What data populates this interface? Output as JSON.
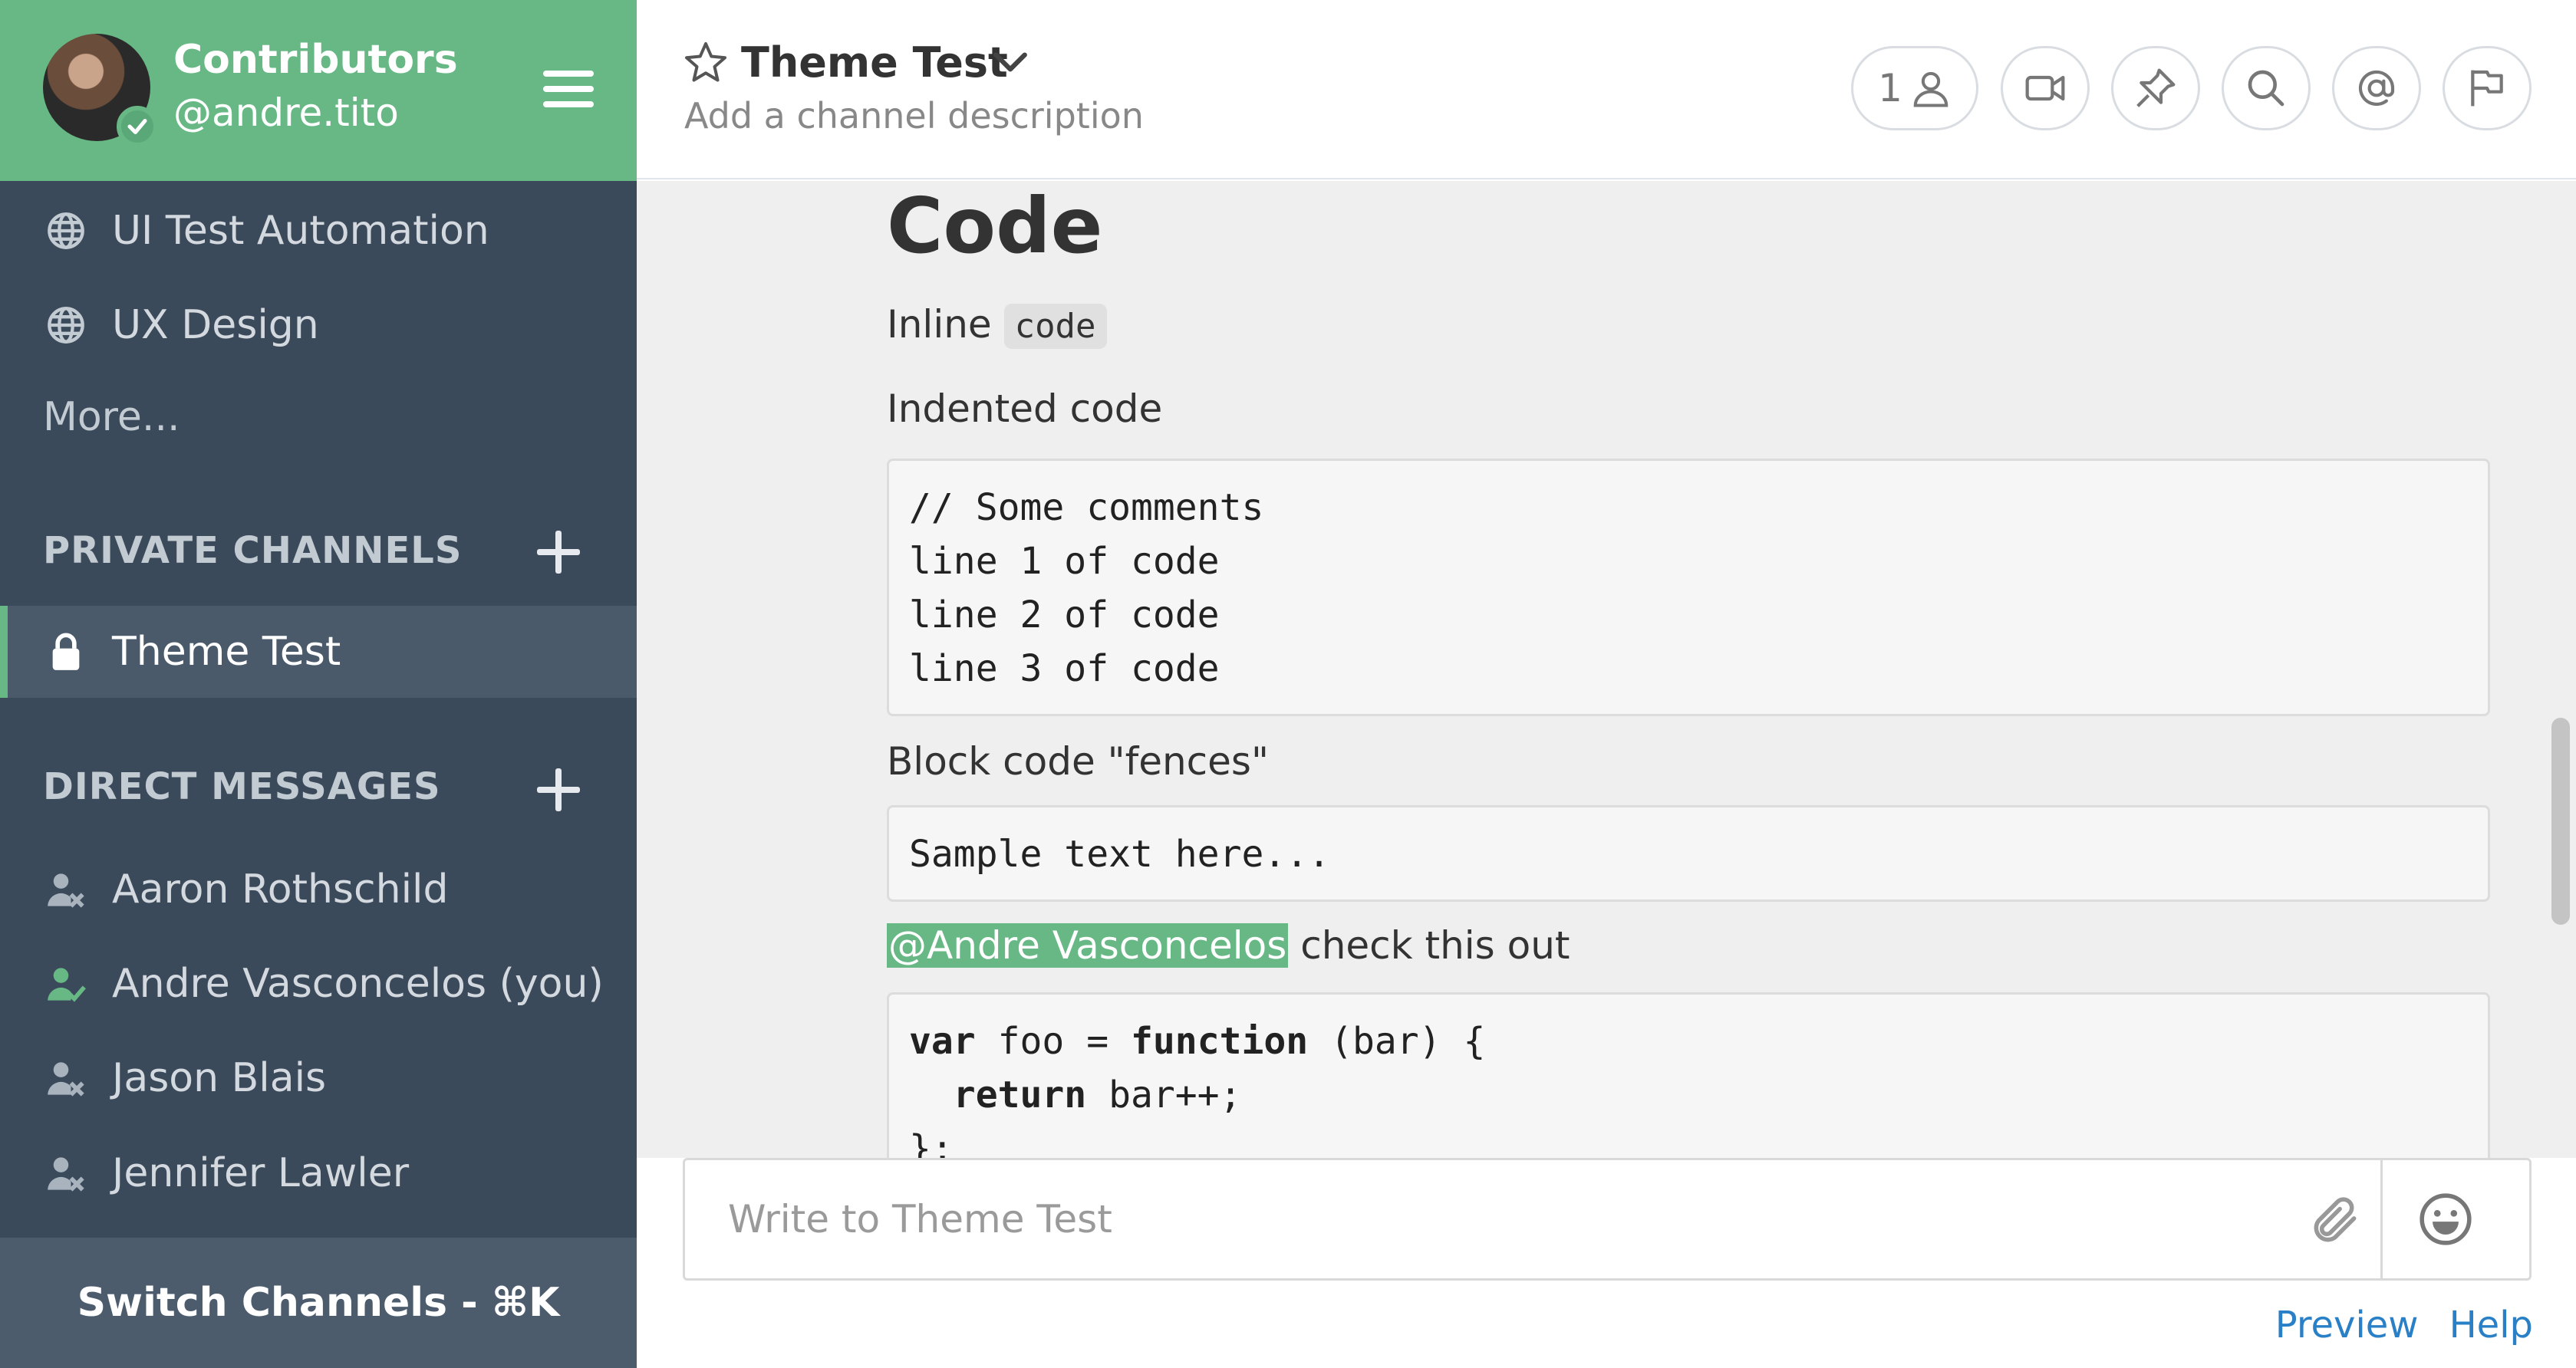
{
  "team": {
    "name": "Contributors",
    "username": "@andre.tito"
  },
  "sidebar": {
    "public_channels": [
      {
        "label": "UI Test Automation",
        "icon": "globe-icon"
      },
      {
        "label": "UX Design",
        "icon": "globe-icon"
      }
    ],
    "more_label": "More...",
    "private_title": "PRIVATE CHANNELS",
    "private_channels": [
      {
        "label": "Theme Test",
        "icon": "lock-icon",
        "active": true
      }
    ],
    "direct_title": "DIRECT MESSAGES",
    "direct_messages": [
      {
        "label": "Aaron Rothschild",
        "status": "offline"
      },
      {
        "label": "Andre Vasconcelos (you)",
        "status": "online"
      },
      {
        "label": "Jason Blais",
        "status": "offline"
      },
      {
        "label": "Jennifer Lawler",
        "status": "offline"
      }
    ],
    "switch_label": "Switch Channels - ⌘K"
  },
  "header": {
    "title": "Theme Test",
    "description": "Add a channel description",
    "member_count": "1"
  },
  "post": {
    "heading": "Code",
    "inline_prefix": "Inline",
    "inline_code": "code",
    "indented_label": "Indented code",
    "indented_code": "// Some comments\nline 1 of code\nline 2 of code\nline 3 of code",
    "fences_label": "Block code \"fences\"",
    "fences_code": "Sample text here...",
    "mention": "@Andre Vasconcelos",
    "mention_suffix": " check this out",
    "js_line1_kw1": "var",
    "js_line1_mid": " foo = ",
    "js_line1_kw2": "function",
    "js_line1_end": " (bar) {",
    "js_line2_indent": "  ",
    "js_line2_kw": "return",
    "js_line2_end": " bar++;",
    "js_line3": "};"
  },
  "composer": {
    "placeholder": "Write to Theme Test",
    "preview_label": "Preview",
    "help_label": "Help"
  },
  "colors": {
    "sidebar_bg": "#3b4a5b",
    "team_header_bg": "#67b885",
    "mention_bg": "#67b885",
    "link": "#2a80c7"
  }
}
